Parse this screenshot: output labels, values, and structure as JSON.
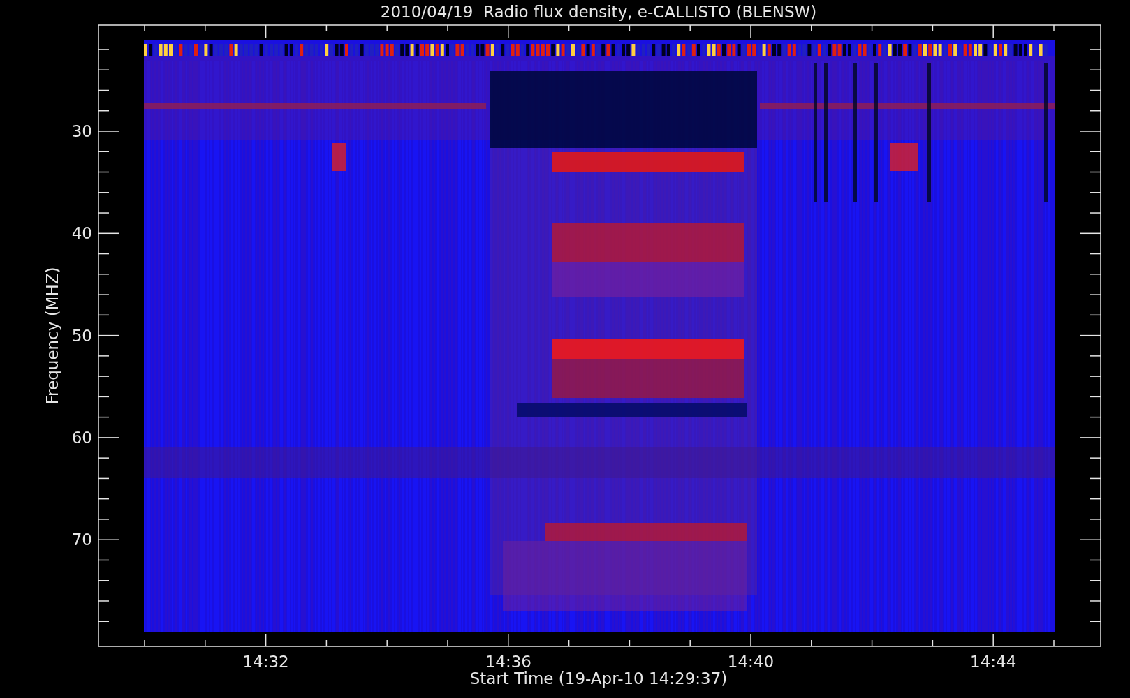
{
  "title": "2010/04/19  Radio flux density, e-CALLISTO (BLENSW)",
  "y_axis": {
    "label": "Frequency (MHZ)",
    "ticks": [
      "30",
      "40",
      "50",
      "60",
      "70"
    ]
  },
  "x_axis": {
    "label": "Start Time (19-Apr-10 14:29:37)",
    "ticks": [
      "14:32",
      "14:36",
      "14:40",
      "14:44"
    ]
  }
}
